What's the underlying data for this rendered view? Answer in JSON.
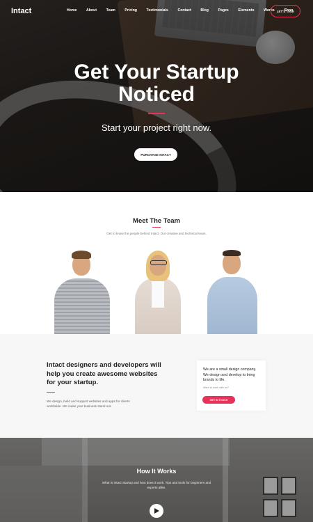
{
  "brand": {
    "logo": "Intact",
    "accent": "#e8325a"
  },
  "nav": {
    "items": [
      "Home",
      "About",
      "Team",
      "Pricing",
      "Testimonials",
      "Contact",
      "Blog",
      "Pages",
      "Elements",
      "Works",
      "Shop"
    ],
    "cta": "LET'S TALK"
  },
  "hero": {
    "title_line1": "Get Your Startup",
    "title_line2": "Noticed",
    "subtitle": "Start your project right now.",
    "button": "PURCHASE INTACT"
  },
  "team": {
    "title": "Meet The Team",
    "subtitle": "Get to know the people behind Intact. Our creative and technical team."
  },
  "feature": {
    "heading": "Intact designers and developers will help you create awesome websites for your startup.",
    "text": "We design, build and support websites and apps for clients worldwide. We make your business stand out.",
    "card": {
      "text": "We are a small design company. We design and develop to bring brands to life.",
      "small": "Want to work with us?",
      "button": "GET IN TOUCH"
    }
  },
  "how": {
    "title": "How It Works",
    "subtitle": "What is Intact Startup and how does it work. Tips and tools for beginners and experts alike."
  },
  "icons": {
    "play": "play-icon"
  }
}
